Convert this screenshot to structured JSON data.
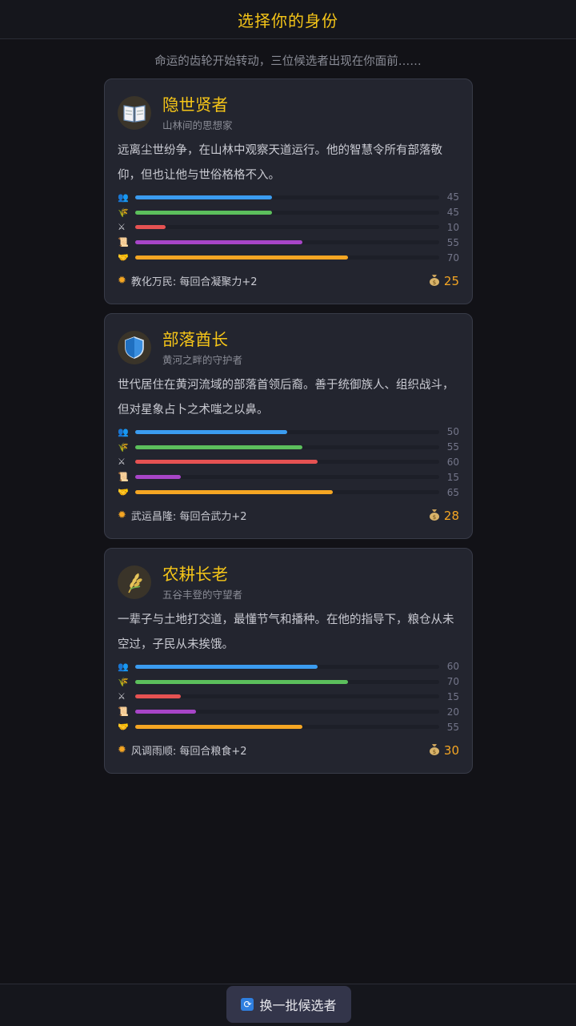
{
  "header": {
    "title": "选择你的身份"
  },
  "subtitle": "命运的齿轮开始转动，三位候选者出现在你面前……",
  "colors": {
    "accent": "#f5c518",
    "people": "#3b9cf0",
    "grain": "#5cbf5c",
    "force": "#e65252",
    "culture": "#a845c8",
    "favor": "#f5a623"
  },
  "stat_icons": [
    "people-icon",
    "grain-icon",
    "swords-icon",
    "scroll-icon",
    "handshake-icon"
  ],
  "candidates": [
    {
      "icon": "book-icon",
      "name": "隐世贤者",
      "tag": "山林间的思想家",
      "desc": "远离尘世纷争，在山林中观察天道运行。他的智慧令所有部落敬仰，但也让他与世俗格格不入。",
      "stats": [
        45,
        45,
        10,
        55,
        70
      ],
      "ability": "教化万民: 每回合凝聚力+2",
      "cost": "25"
    },
    {
      "icon": "shield-icon",
      "name": "部落酋长",
      "tag": "黄河之畔的守护者",
      "desc": "世代居住在黄河流域的部落首领后裔。善于统御族人、组织战斗，但对星象占卜之术嗤之以鼻。",
      "stats": [
        50,
        55,
        60,
        15,
        65
      ],
      "ability": "武运昌隆: 每回合武力+2",
      "cost": "28"
    },
    {
      "icon": "wheat-icon",
      "name": "农耕长老",
      "tag": "五谷丰登的守望者",
      "desc": "一辈子与土地打交道，最懂节气和播种。在他的指导下，粮仓从未空过，子民从未挨饿。",
      "stats": [
        60,
        70,
        15,
        20,
        55
      ],
      "ability": "风调雨顺: 每回合粮食+2",
      "cost": "30"
    }
  ],
  "refresh_button": {
    "label": "换一批候选者"
  }
}
